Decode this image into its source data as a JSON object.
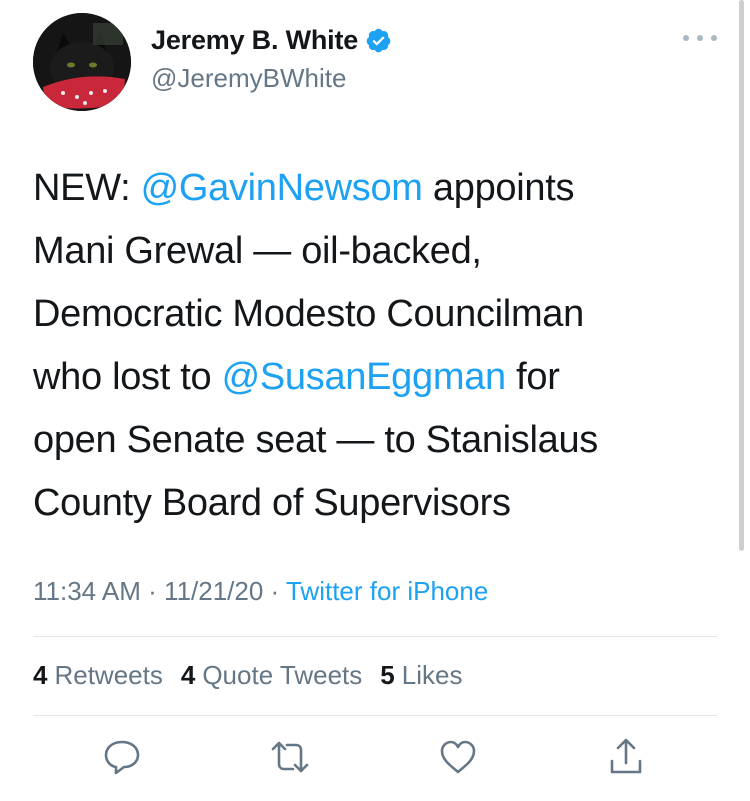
{
  "user": {
    "name": "Jeremy B. White",
    "handle": "@JeremyBWhite",
    "verified": true,
    "avatar_icon": "cat-avatar-icon"
  },
  "tweet": {
    "line1_pre": "NEW: ",
    "mention1": "@GavinNewsom",
    "line1_post": " appoints",
    "line2": "Mani Grewal — oil-backed,",
    "line3": "Democratic Modesto Councilman",
    "line4_pre": "who lost to ",
    "mention2": "@SusanEggman",
    "line4_post": " for",
    "line5": "open Senate seat — to Stanislaus",
    "line6": "County Board of Supervisors"
  },
  "meta": {
    "time": "11:34 AM",
    "sep1": " · ",
    "date": "11/21/20",
    "sep2": " · ",
    "source": "Twitter for iPhone"
  },
  "stats": {
    "retweets_count": "4",
    "retweets_label": "Retweets",
    "quotes_count": "4",
    "quotes_label": "Quote Tweets",
    "likes_count": "5",
    "likes_label": "Likes"
  },
  "actions": [
    "reply-icon",
    "retweet-icon",
    "like-icon",
    "share-icon"
  ],
  "colors": {
    "link": "#1da1f2",
    "secondary_text": "#657786",
    "primary_text": "#14171a",
    "divider": "#e1e8ed"
  }
}
